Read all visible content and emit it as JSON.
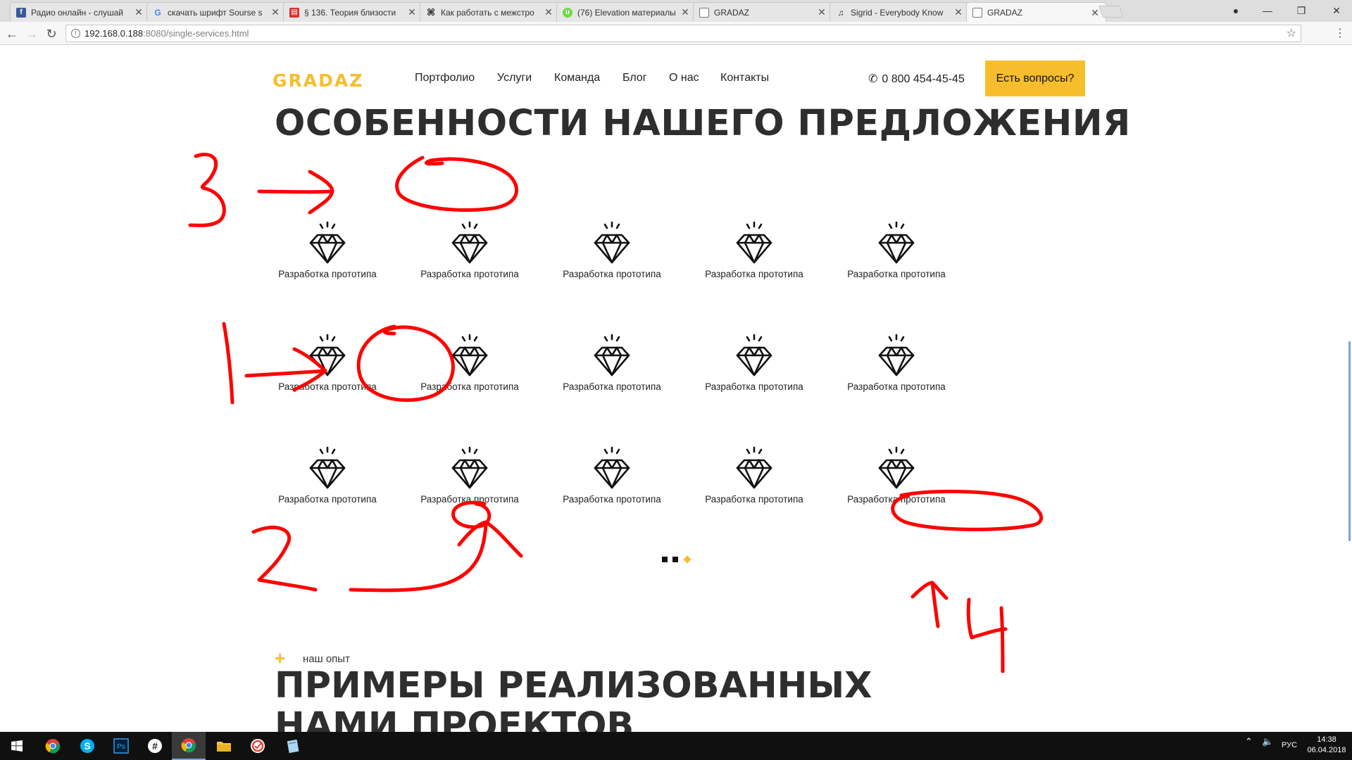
{
  "browser": {
    "tabs": [
      {
        "title": "Радио онлайн - слушай",
        "icon": "facebook-icon",
        "color": "#3b5998"
      },
      {
        "title": "скачать шрифт Sourse s",
        "icon": "google-icon",
        "color": "#ffffff"
      },
      {
        "title": "§ 136. Теория близости",
        "icon": "book-icon",
        "color": "#d9322e"
      },
      {
        "title": "Как работать с межстро",
        "icon": "command-icon",
        "color": "#ffffff"
      },
      {
        "title": "(76) Elevation материалы",
        "icon": "upwork-icon",
        "color": "#6fda44"
      },
      {
        "title": "GRADAZ",
        "icon": "page-icon",
        "color": "#ffffff"
      },
      {
        "title": "Sigrid - Everybody Know",
        "icon": "music-icon",
        "color": "#ffffff"
      },
      {
        "title": "GRADAZ",
        "icon": "page-icon",
        "color": "#ffffff",
        "active": true
      }
    ],
    "url_host": "192.168.0.188",
    "url_rest": ":8080/single-services.html"
  },
  "site": {
    "logo": "GRADAZ",
    "nav": [
      "Портфолио",
      "Услуги",
      "Команда",
      "Блог",
      "О нас",
      "Контакты"
    ],
    "phone": "0 800 454-45-45",
    "cta": "Есть вопросы?",
    "colors": {
      "accent": "#f6be2c",
      "text": "#2e2e2e"
    }
  },
  "features": {
    "title": "ОСОБЕННОСТИ НАШЕГО ПРЕДЛОЖЕНИЯ",
    "icon": "diamond-icon",
    "items": [
      "Разработка прототипа",
      "Разработка прототипа",
      "Разработка прототипа",
      "Разработка прототипа",
      "Разработка прототипа",
      "Разработка прототипа",
      "Разработка прототипа",
      "Разработка прототипа",
      "Разработка прототипа",
      "Разработка прототипа",
      "Разработка прототипа",
      "Разработка прототипа",
      "Разработка прототипа",
      "Разработка прототипа",
      "Разработка прототипа"
    ],
    "pagination": {
      "count": 3,
      "active": 3
    }
  },
  "projects": {
    "eyebrow": "наш опыт",
    "title": "ПРИМЕРЫ РЕАЛИЗОВАННЫХ НАМИ ПРОЕКТОВ"
  },
  "annotations": {
    "color": "#ff0000",
    "numbers": [
      "3",
      "1",
      "2",
      "4"
    ]
  },
  "taskbar": {
    "apps": [
      "windows-start-icon",
      "chrome-icon",
      "skype-icon",
      "photoshop-icon",
      "slack-icon",
      "chrome-active-icon",
      "folder-icon",
      "todoist-icon",
      "notepad-icon"
    ],
    "language": "РУС",
    "time": "14:38",
    "date": "06.04.2018"
  }
}
